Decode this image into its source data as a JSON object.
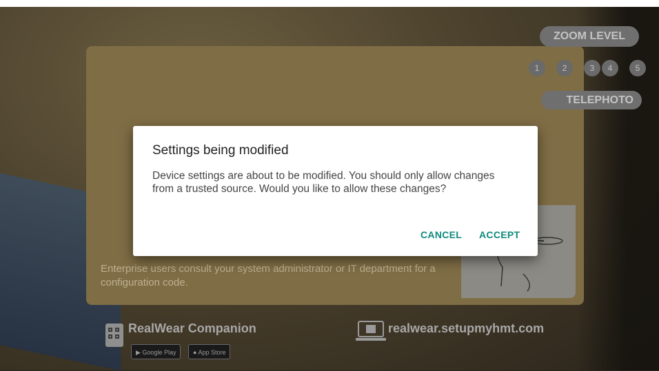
{
  "dialog": {
    "title": "Settings being modified",
    "message": "Device settings are about to be modified. You should only allow changes from a trusted source. Would you like to allow these changes?",
    "cancel_label": "CANCEL",
    "accept_label": "ACCEPT",
    "accent_color": "#0f8a7e"
  },
  "background_card": {
    "text": "Enterprise users consult your system administrator or IT department for a configuration code."
  },
  "zoom": {
    "label": "ZOOM LEVEL",
    "levels": [
      "1",
      "2",
      "3",
      "4",
      "5"
    ],
    "mode": "TELEPHOTO"
  },
  "footer": {
    "companion_label": "RealWear Companion",
    "google_play": "Google Play",
    "app_store": "App Store",
    "url": "realwear.setupmyhmt.com"
  }
}
